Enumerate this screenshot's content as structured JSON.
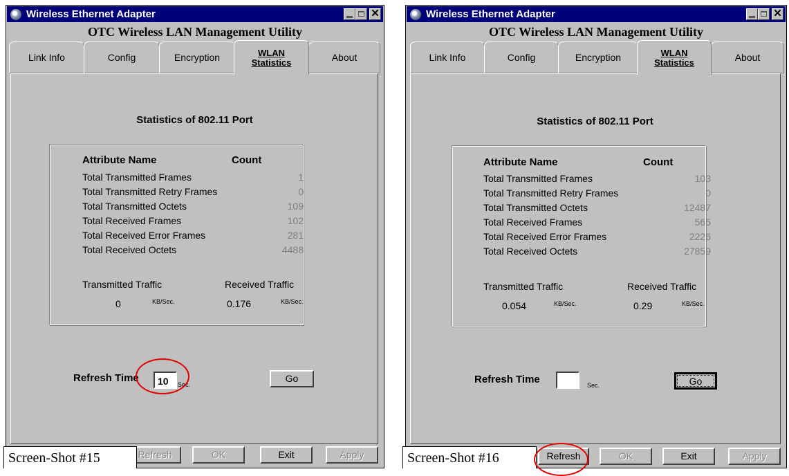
{
  "windows": [
    {
      "title": "Wireless Ethernet Adapter",
      "subtitle": "OTC Wireless LAN Management Utility",
      "tabs": [
        "Link Info",
        "Config",
        "Encryption",
        "WLAN Statistics",
        "About"
      ],
      "tabs_active_line1": "WLAN",
      "tabs_active_line2": "Statistics",
      "stats_title": "Statistics of 802.11 Port",
      "attr_header": "Attribute Name",
      "count_header": "Count",
      "attributes": [
        {
          "name": "Total Transmitted Frames",
          "count": "1"
        },
        {
          "name": "Total Transmitted Retry Frames",
          "count": "0"
        },
        {
          "name": "Total Transmitted Octets",
          "count": "109"
        },
        {
          "name": "Total Received Frames",
          "count": "102"
        },
        {
          "name": "Total Received Error Frames",
          "count": "281"
        },
        {
          "name": "Total Received Octets",
          "count": "4488"
        }
      ],
      "tx_label": "Transmitted Traffic",
      "rx_label": "Received Traffic",
      "tx_value": "0",
      "rx_value": "0.176",
      "unit": "KB/Sec.",
      "refresh_label": "Refresh Time",
      "refresh_value": "10",
      "refresh_unit": "Sec.",
      "go_label": "Go",
      "buttons": {
        "refresh": "Refresh",
        "ok": "OK",
        "exit": "Exit",
        "apply": "Apply"
      },
      "caption": "Screen-Shot #15"
    },
    {
      "title": "Wireless Ethernet Adapter",
      "subtitle": "OTC Wireless LAN Management Utility",
      "tabs": [
        "Link Info",
        "Config",
        "Encryption",
        "WLAN Statistics",
        "About"
      ],
      "tabs_active_line1": "WLAN",
      "tabs_active_line2": "Statistics",
      "stats_title": "Statistics of 802.11 Port",
      "attr_header": "Attribute Name",
      "count_header": "Count",
      "attributes": [
        {
          "name": "Total Transmitted Frames",
          "count": "103"
        },
        {
          "name": "Total Transmitted Retry Frames",
          "count": "0"
        },
        {
          "name": "Total Transmitted Octets",
          "count": "12487"
        },
        {
          "name": "Total Received Frames",
          "count": "565"
        },
        {
          "name": "Total Received Error Frames",
          "count": "2226"
        },
        {
          "name": "Total Received Octets",
          "count": "27859"
        }
      ],
      "tx_label": "Transmitted Traffic",
      "rx_label": "Received Traffic",
      "tx_value": "0.054",
      "rx_value": "0.29",
      "unit": "KB/Sec.",
      "refresh_label": "Refresh Time",
      "refresh_value": "",
      "refresh_unit": "Sec.",
      "go_label": "Go",
      "buttons": {
        "refresh": "Refresh",
        "ok": "OK",
        "exit": "Exit",
        "apply": "Apply"
      },
      "caption": "Screen-Shot #16"
    }
  ],
  "colors": {
    "titlebar": "#00007b",
    "annotation": "#e00000",
    "disabled_text": "#8a8a8a",
    "count_text": "#7f7f7f"
  }
}
